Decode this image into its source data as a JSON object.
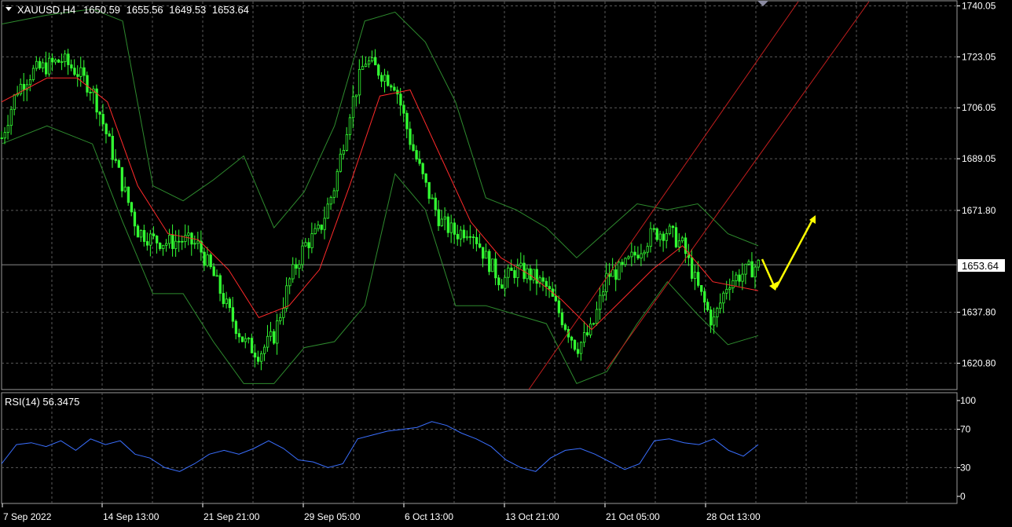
{
  "header": {
    "symbol": "XAUUSD,H4",
    "open": "1650.59",
    "high": "1655.56",
    "low": "1649.53",
    "close": "1653.64"
  },
  "rsi_header": "RSI(14) 56.3475",
  "colors": {
    "background": "#000000",
    "grid": "#5a5a5a",
    "candles": "#33ff33",
    "bands": "#2e8b2e",
    "moving_average": "#ff2a2a",
    "channel": "#c41e1e",
    "rsi_line": "#3a6fff",
    "arrows": "#ffff00",
    "axis_text": "#ffffff"
  },
  "chart_data": [
    {
      "type": "candlestick",
      "symbol": "XAUUSD",
      "timeframe": "H4",
      "ohlc_current": {
        "open": 1650.59,
        "high": 1655.56,
        "low": 1649.53,
        "close": 1653.64
      },
      "current_price_label": "1653.64",
      "y_ticks": [
        "1740.05",
        "1723.05",
        "1706.05",
        "1689.05",
        "1671.80",
        "1637.80",
        "1620.80"
      ],
      "ylim": [
        1612,
        1741.5
      ],
      "x_ticks": [
        "7 Sep 2022",
        "14 Sep 13:00",
        "21 Sep 21:00",
        "29 Sep 05:00",
        "6 Oct 13:00",
        "13 Oct 21:00",
        "21 Oct 05:00",
        "28 Oct 13:00"
      ],
      "grid": true,
      "overlays": [
        "Bollinger Bands",
        "Moving Average",
        "Ascending channel",
        "Projection arrows"
      ],
      "close_path": [
        [
          0,
          1696
        ],
        [
          0.02,
          1712
        ],
        [
          0.04,
          1718
        ],
        [
          0.06,
          1720
        ],
        [
          0.08,
          1722
        ],
        [
          0.1,
          1718
        ],
        [
          0.12,
          1712
        ],
        [
          0.14,
          1696
        ],
        [
          0.16,
          1680
        ],
        [
          0.18,
          1665
        ],
        [
          0.2,
          1662
        ],
        [
          0.22,
          1661
        ],
        [
          0.24,
          1662
        ],
        [
          0.26,
          1660
        ],
        [
          0.28,
          1650
        ],
        [
          0.3,
          1638
        ],
        [
          0.32,
          1628
        ],
        [
          0.34,
          1624
        ],
        [
          0.36,
          1630
        ],
        [
          0.38,
          1648
        ],
        [
          0.4,
          1660
        ],
        [
          0.42,
          1665
        ],
        [
          0.44,
          1680
        ],
        [
          0.46,
          1705
        ],
        [
          0.48,
          1722
        ],
        [
          0.5,
          1718
        ],
        [
          0.52,
          1714
        ],
        [
          0.54,
          1695
        ],
        [
          0.56,
          1680
        ],
        [
          0.58,
          1668
        ],
        [
          0.6,
          1664
        ],
        [
          0.62,
          1666
        ],
        [
          0.64,
          1656
        ],
        [
          0.66,
          1648
        ],
        [
          0.68,
          1652
        ],
        [
          0.7,
          1650
        ],
        [
          0.72,
          1646
        ],
        [
          0.74,
          1636
        ],
        [
          0.76,
          1626
        ],
        [
          0.78,
          1632
        ],
        [
          0.8,
          1650
        ],
        [
          0.82,
          1652
        ],
        [
          0.84,
          1658
        ],
        [
          0.86,
          1664
        ],
        [
          0.88,
          1665
        ],
        [
          0.9,
          1660
        ],
        [
          0.92,
          1646
        ],
        [
          0.94,
          1634
        ],
        [
          0.96,
          1648
        ],
        [
          1,
          1653.64
        ]
      ],
      "bb_upper": [
        [
          0,
          1734
        ],
        [
          0.06,
          1737
        ],
        [
          0.12,
          1739
        ],
        [
          0.16,
          1735
        ],
        [
          0.2,
          1680
        ],
        [
          0.24,
          1675
        ],
        [
          0.28,
          1682
        ],
        [
          0.32,
          1690
        ],
        [
          0.36,
          1666
        ],
        [
          0.4,
          1678
        ],
        [
          0.44,
          1700
        ],
        [
          0.48,
          1735
        ],
        [
          0.52,
          1738
        ],
        [
          0.56,
          1728
        ],
        [
          0.6,
          1708
        ],
        [
          0.64,
          1676
        ],
        [
          0.68,
          1672
        ],
        [
          0.72,
          1666
        ],
        [
          0.76,
          1656
        ],
        [
          0.8,
          1665
        ],
        [
          0.84,
          1674
        ],
        [
          0.88,
          1672
        ],
        [
          0.92,
          1674
        ],
        [
          0.96,
          1664
        ],
        [
          1,
          1660
        ]
      ],
      "bb_lower": [
        [
          0,
          1694
        ],
        [
          0.06,
          1700
        ],
        [
          0.12,
          1694
        ],
        [
          0.16,
          1668
        ],
        [
          0.2,
          1644
        ],
        [
          0.24,
          1644
        ],
        [
          0.28,
          1628
        ],
        [
          0.32,
          1614
        ],
        [
          0.36,
          1614
        ],
        [
          0.4,
          1626
        ],
        [
          0.44,
          1628
        ],
        [
          0.48,
          1640
        ],
        [
          0.52,
          1684
        ],
        [
          0.56,
          1672
        ],
        [
          0.6,
          1640
        ],
        [
          0.64,
          1640
        ],
        [
          0.68,
          1637
        ],
        [
          0.72,
          1634
        ],
        [
          0.76,
          1614
        ],
        [
          0.8,
          1618
        ],
        [
          0.84,
          1634
        ],
        [
          0.88,
          1648
        ],
        [
          0.92,
          1637
        ],
        [
          0.96,
          1627
        ],
        [
          1,
          1630
        ]
      ],
      "ma": [
        [
          0,
          1708
        ],
        [
          0.06,
          1716
        ],
        [
          0.1,
          1716
        ],
        [
          0.14,
          1708
        ],
        [
          0.18,
          1680
        ],
        [
          0.22,
          1664
        ],
        [
          0.26,
          1662
        ],
        [
          0.3,
          1652
        ],
        [
          0.34,
          1636
        ],
        [
          0.38,
          1640
        ],
        [
          0.42,
          1652
        ],
        [
          0.46,
          1680
        ],
        [
          0.5,
          1710
        ],
        [
          0.54,
          1712
        ],
        [
          0.58,
          1690
        ],
        [
          0.62,
          1668
        ],
        [
          0.66,
          1656
        ],
        [
          0.7,
          1650
        ],
        [
          0.74,
          1642
        ],
        [
          0.78,
          1632
        ],
        [
          0.82,
          1642
        ],
        [
          0.86,
          1652
        ],
        [
          0.9,
          1660
        ],
        [
          0.94,
          1648
        ],
        [
          1,
          1645
        ]
      ]
    },
    {
      "type": "line",
      "name": "RSI(14)",
      "value_label": "56.3475",
      "y_ticks": [
        "100",
        "70",
        "30",
        "0"
      ],
      "ylim": [
        0,
        100
      ],
      "levels": [
        70,
        30
      ],
      "values": [
        34,
        54,
        56,
        52,
        58,
        48,
        60,
        54,
        58,
        44,
        40,
        30,
        26,
        34,
        44,
        48,
        44,
        50,
        58,
        50,
        38,
        36,
        30,
        34,
        60,
        64,
        68,
        70,
        72,
        78,
        74,
        66,
        60,
        52,
        38,
        30,
        26,
        40,
        48,
        50,
        44,
        36,
        28,
        34,
        58,
        60,
        56,
        54,
        60,
        48,
        42,
        54
      ]
    }
  ]
}
